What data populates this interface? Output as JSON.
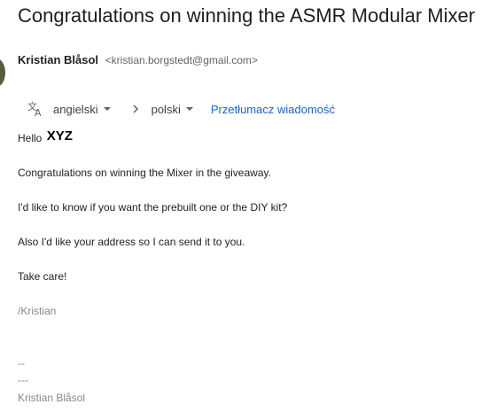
{
  "email": {
    "subject": "Congratulations on winning the ASMR Modular Mixer",
    "sender": {
      "name": "Kristian Blåsol",
      "email": "<kristian.borgstedt@gmail.com>"
    },
    "translate_bar": {
      "icon": "translate-icon",
      "source_language": "angielski",
      "target_language": "polski",
      "translate_link": "Przetłumacz wiadomość"
    },
    "body": {
      "greeting": "Hello",
      "greeting_name": "XYZ",
      "line1": "Congratulations on winning the Mixer in the giveaway.",
      "line2": "I'd like to know if you want the prebuilt one or the DIY kit?",
      "line3": "Also I'd like your address so I can send it to you.",
      "line4": "Take care!",
      "signoff": "/Kristian"
    },
    "signature": {
      "separator1": "--",
      "separator2": "---",
      "name": "Kristian Blåsol"
    }
  },
  "colors": {
    "link": "#1a62c9",
    "muted": "#888888",
    "avatar": "#5c5a3c"
  }
}
